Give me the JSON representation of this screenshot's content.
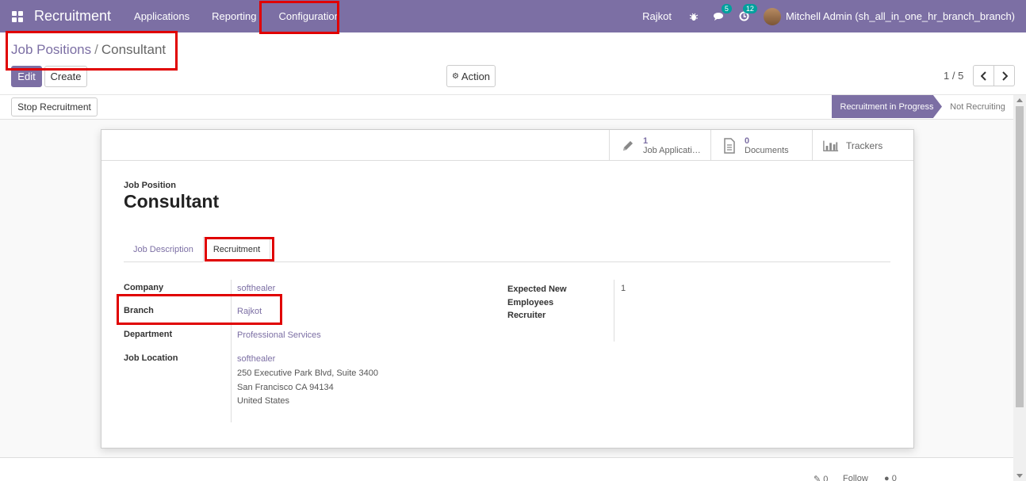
{
  "navbar": {
    "brand": "Recruitment",
    "menu": [
      "Applications",
      "Reporting",
      "Configuration"
    ],
    "company": "Rajkot",
    "messages_badge": "5",
    "activities_badge": "12",
    "user": "Mitchell Admin (sh_all_in_one_hr_branch_branch)"
  },
  "breadcrumb": {
    "parent": "Job Positions",
    "separator": "/",
    "current": "Consultant"
  },
  "buttons": {
    "edit": "Edit",
    "create": "Create",
    "action": "Action",
    "stop": "Stop Recruitment"
  },
  "pager": "1 / 5",
  "stages": {
    "active": "Recruitment in Progress",
    "inactive": "Not Recruiting"
  },
  "smart_buttons": {
    "applications_count": "1",
    "applications_label": "Job Applicati…",
    "documents_count": "0",
    "documents_label": "Documents",
    "trackers_label": "Trackers"
  },
  "record": {
    "label": "Job Position",
    "title": "Consultant"
  },
  "tabs": [
    "Job Description",
    "Recruitment"
  ],
  "fields": {
    "company_label": "Company",
    "company_value": "softhealer",
    "branch_label": "Branch",
    "branch_value": "Rajkot",
    "department_label": "Department",
    "department_value": "Professional Services",
    "location_label": "Job Location",
    "location_name": "softhealer",
    "location_line1": "250 Executive Park Blvd, Suite 3400",
    "location_line2": "San Francisco CA 94134",
    "location_line3": "United States",
    "expected_label_1": "Expected New",
    "expected_label_2": "Employees",
    "expected_value": "1",
    "recruiter_label": "Recruiter"
  },
  "chatter": {
    "attachments": "0",
    "follow": "Follow",
    "followers": "0"
  },
  "colors": {
    "brand": "#7c6fa4",
    "highlight": "#e00000"
  }
}
